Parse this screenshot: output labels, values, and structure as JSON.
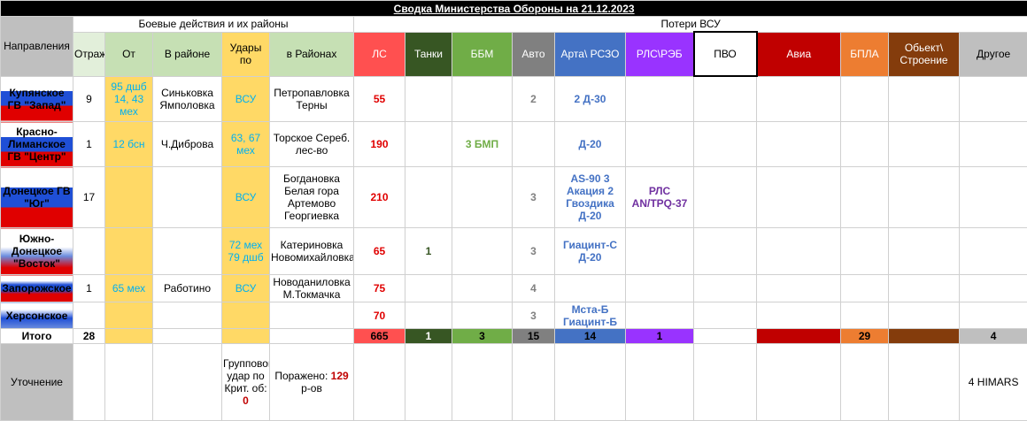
{
  "title": "Сводка Министерства Обороны на 21.12.2023",
  "groups": {
    "combat": "Боевые действия и их районы",
    "losses": "Потери ВСУ"
  },
  "headers": {
    "napr": "Направления",
    "otrazheno": "Отражено",
    "ot": "От",
    "v_rayone": "В районе",
    "udary": "Удары по",
    "v_rayonah": "в Районах",
    "ls": "ЛС",
    "tanki": "Танки",
    "bbm": "ББМ",
    "avto": "Авто",
    "arta": "Арта\\ РСЗО",
    "rls": "РЛС\\РЭБ",
    "pvo": "ПВО",
    "avia": "Авиа",
    "bpla": "БПЛА",
    "obj": "Обьект\\ Строение",
    "drugoe": "Другое"
  },
  "rows": [
    {
      "dir": "Купянское ГВ \"Запад\"",
      "otr": "9",
      "ot": "95 дшб 14, 43 мех",
      "v_rayone": "Синьковка Ямполовка",
      "udary": "ВСУ",
      "v_rayonah": "Петропавловка Терны",
      "ls": "55",
      "tanki": "",
      "bbm": "",
      "avto": "2",
      "arta": "2 Д-30",
      "rls": ""
    },
    {
      "dir": "Красно-Лиманское ГВ \"Центр\"",
      "otr": "1",
      "ot": "12 бсн",
      "v_rayone": "Ч.Диброва",
      "udary": "63, 67 мех",
      "v_rayonah": "Торское Сереб. лес-во",
      "ls": "190",
      "tanki": "",
      "bbm": "3 БМП",
      "avto": "",
      "arta": "Д-20",
      "rls": ""
    },
    {
      "dir": "Донецкое ГВ \"Юг\"",
      "otr": "17",
      "ot": "",
      "v_rayone": "",
      "udary": "ВСУ",
      "v_rayonah": "Богдановка Белая гора Артемово Георгиевка",
      "ls": "210",
      "tanki": "",
      "bbm": "",
      "avto": "3",
      "arta": "AS-90 3 Акация 2 Гвоздика Д-20",
      "rls": "РЛС AN/TPQ-37"
    },
    {
      "dir": "Южно-Донецкое \"Восток\"",
      "otr": "",
      "ot": "",
      "v_rayone": "",
      "udary": "72 мех 79 дшб",
      "v_rayonah": "Катериновка Новомихайловка",
      "ls": "65",
      "tanki": "1",
      "bbm": "",
      "avto": "3",
      "arta": "Гиацинт-С Д-20",
      "rls": ""
    },
    {
      "dir": "Запорожское",
      "otr": "1",
      "ot": "65 мех",
      "v_rayone": "Работино",
      "udary": "ВСУ",
      "v_rayonah": "Новоданиловка М.Токмачка",
      "ls": "75",
      "tanki": "",
      "bbm": "",
      "avto": "4",
      "arta": "",
      "rls": ""
    },
    {
      "dir": "Херсонское",
      "otr": "",
      "ot": "",
      "v_rayone": "",
      "udary": "",
      "v_rayonah": "",
      "ls": "70",
      "tanki": "",
      "bbm": "",
      "avto": "3",
      "arta": "Мста-Б Гиацинт-Б",
      "rls": ""
    }
  ],
  "totals": {
    "label": "Итого",
    "otr": "28",
    "ls": "665",
    "tanki": "1",
    "bbm": "3",
    "avto": "15",
    "arta": "14",
    "rls": "1",
    "bpla": "29",
    "drugoe": "4"
  },
  "note": {
    "label": "Уточнение",
    "udary_text": "Групповой удар по Крит. об:",
    "udary_value": "0",
    "v_rayonah_text": "Поражено:",
    "v_rayonah_value": "129",
    "v_rayonah_suffix": "р-ов",
    "drugoe": "4 HIMARS"
  }
}
